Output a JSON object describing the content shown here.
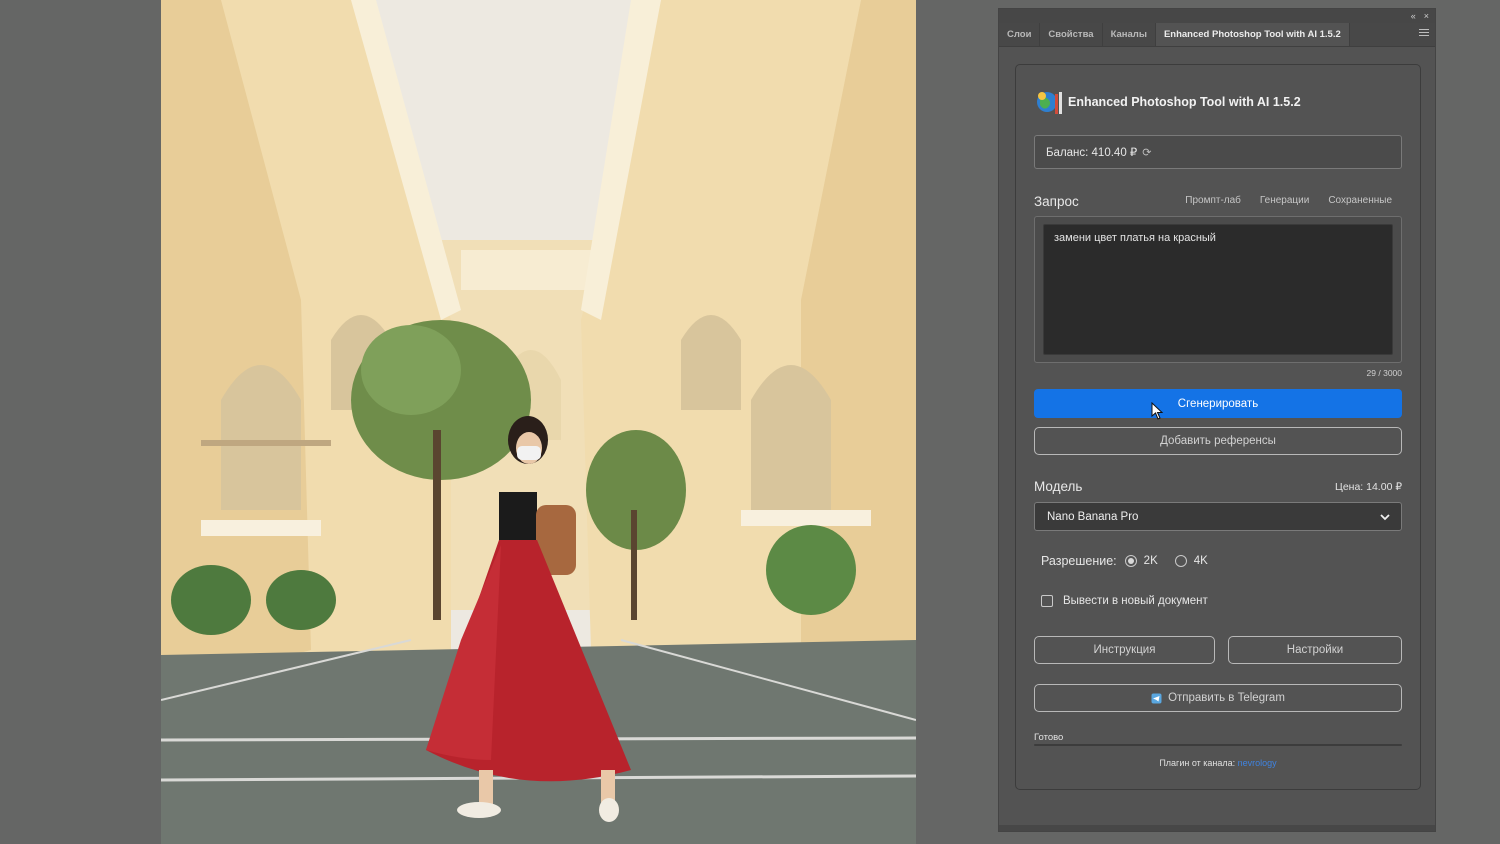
{
  "window_controls": {
    "collapse": "«",
    "close": "×"
  },
  "tabs": [
    {
      "label": "Слои"
    },
    {
      "label": "Свойства"
    },
    {
      "label": "Каналы"
    },
    {
      "label": "Enhanced Photoshop Tool with AI 1.5.2",
      "active": true
    }
  ],
  "header": {
    "title": "Enhanced Photoshop Tool with AI 1.5.2"
  },
  "balance": {
    "text": "Баланс: 410.40 ₽",
    "refresh_symbol": "⟳"
  },
  "query": {
    "label": "Запрос",
    "links": [
      "Промпт-лаб",
      "Генерации",
      "Сохраненные"
    ],
    "prompt_value": "замени цвет платья на красный",
    "counter": "29 / 3000"
  },
  "buttons": {
    "generate": "Сгенерировать",
    "add_refs": "Добавить референсы",
    "instructions": "Инструкция",
    "settings": "Настройки",
    "telegram": "Отправить в Telegram"
  },
  "model": {
    "label": "Модель",
    "price": "Цена: 14.00 ₽",
    "selected": "Nano Banana Pro"
  },
  "resolution": {
    "label": "Разрешение:",
    "options": [
      {
        "label": "2K",
        "checked": true
      },
      {
        "label": "4K",
        "checked": false
      }
    ]
  },
  "new_document": {
    "label": "Вывести в новый документ",
    "checked": false
  },
  "status": {
    "text": "Готово"
  },
  "footer": {
    "prefix": "Плагин от канала:",
    "link": "nevrology"
  },
  "colors": {
    "accent": "#1473e6",
    "panel_bg": "#535353",
    "canvas_bg": "#656665",
    "dress": "#b8232c"
  }
}
